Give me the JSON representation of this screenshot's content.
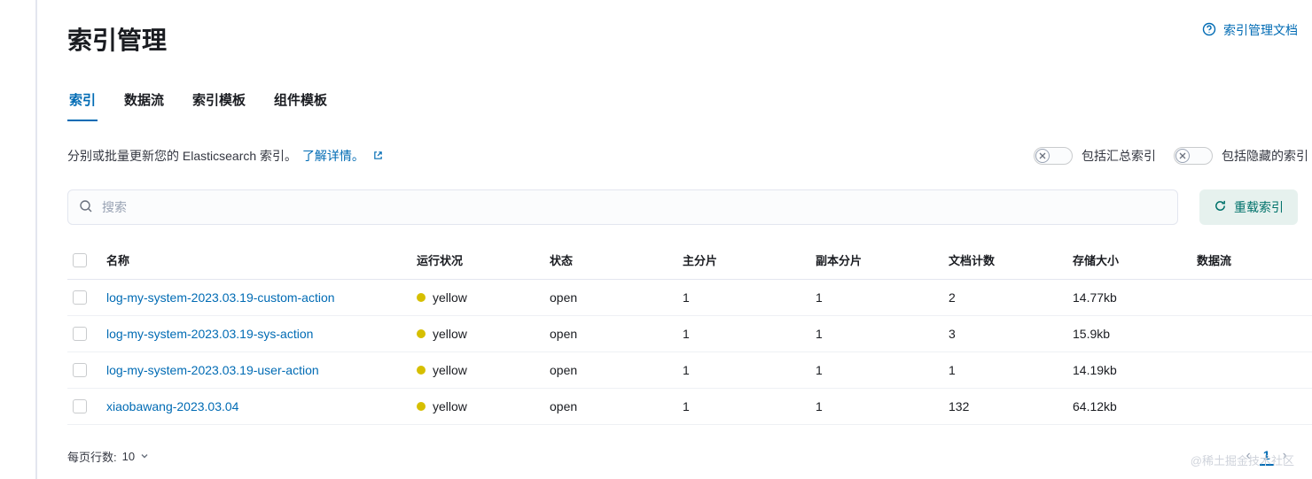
{
  "header": {
    "title": "索引管理",
    "docs_link": "索引管理文档"
  },
  "tabs": [
    "索引",
    "数据流",
    "索引模板",
    "组件模板"
  ],
  "description": {
    "text": "分别或批量更新您的 Elasticsearch 索引。",
    "learn_more": "了解详情。"
  },
  "toggles": {
    "rollup": "包括汇总索引",
    "hidden": "包括隐藏的索引"
  },
  "search": {
    "placeholder": "搜索"
  },
  "reload_button": "重载索引",
  "columns": {
    "name": "名称",
    "health": "运行状况",
    "status": "状态",
    "primaries": "主分片",
    "replicas": "副本分片",
    "docs": "文档计数",
    "size": "存储大小",
    "stream": "数据流"
  },
  "rows": [
    {
      "name": "log-my-system-2023.03.19-custom-action",
      "health": "yellow",
      "status": "open",
      "primaries": "1",
      "replicas": "1",
      "docs": "2",
      "size": "14.77kb",
      "stream": ""
    },
    {
      "name": "log-my-system-2023.03.19-sys-action",
      "health": "yellow",
      "status": "open",
      "primaries": "1",
      "replicas": "1",
      "docs": "3",
      "size": "15.9kb",
      "stream": ""
    },
    {
      "name": "log-my-system-2023.03.19-user-action",
      "health": "yellow",
      "status": "open",
      "primaries": "1",
      "replicas": "1",
      "docs": "1",
      "size": "14.19kb",
      "stream": ""
    },
    {
      "name": "xiaobawang-2023.03.04",
      "health": "yellow",
      "status": "open",
      "primaries": "1",
      "replicas": "1",
      "docs": "132",
      "size": "64.12kb",
      "stream": ""
    }
  ],
  "footer": {
    "rows_per_page_label": "每页行数:",
    "rows_per_page_value": "10",
    "current_page": "1"
  },
  "watermark": "@稀土掘金技术社区"
}
